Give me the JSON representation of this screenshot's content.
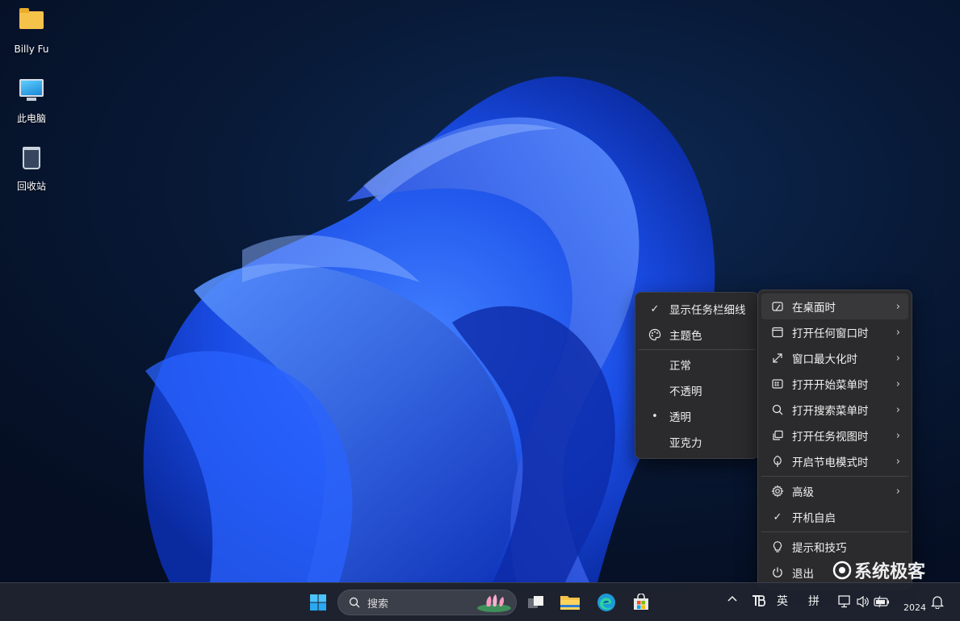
{
  "desktop": {
    "icons": [
      {
        "label": "Billy Fu",
        "icon": "folder-icon"
      },
      {
        "label": "此电脑",
        "icon": "computer-icon"
      },
      {
        "label": "回收站",
        "icon": "recycle-bin-icon"
      }
    ]
  },
  "submenu": {
    "items": [
      {
        "label": "显示任务栏细线",
        "icon": "check-icon",
        "checked": true
      },
      {
        "label": "主题色",
        "icon": "palette-icon"
      },
      {
        "label": "正常"
      },
      {
        "label": "不透明"
      },
      {
        "label": "透明",
        "selected": true
      },
      {
        "label": "亚克力"
      }
    ]
  },
  "main_menu": {
    "items": [
      {
        "label": "在桌面时",
        "icon": "desktop-icon"
      },
      {
        "label": "打开任何窗口时",
        "icon": "window-icon"
      },
      {
        "label": "窗口最大化时",
        "icon": "maximize-icon"
      },
      {
        "label": "打开开始菜单时",
        "icon": "start-menu-icon"
      },
      {
        "label": "打开搜索菜单时",
        "icon": "search-icon"
      },
      {
        "label": "打开任务视图时",
        "icon": "task-view-icon"
      },
      {
        "label": "开启节电模式时",
        "icon": "leaf-icon"
      },
      {
        "label": "高级",
        "icon": "gear-icon"
      },
      {
        "label": "开机自启",
        "icon": "check-icon"
      },
      {
        "label": "提示和技巧",
        "icon": "lightbulb-icon"
      },
      {
        "label": "退出",
        "icon": "power-icon"
      }
    ]
  },
  "taskbar": {
    "search_placeholder": "搜索",
    "tray": {
      "ime_lang": "英",
      "ime_mode": "拼",
      "clock": "2024"
    }
  },
  "watermark": "系统极客",
  "colors": {
    "menu_bg": "#2b2b2d",
    "accent": "#1a5cff",
    "taskbar_bg": "#202430"
  }
}
